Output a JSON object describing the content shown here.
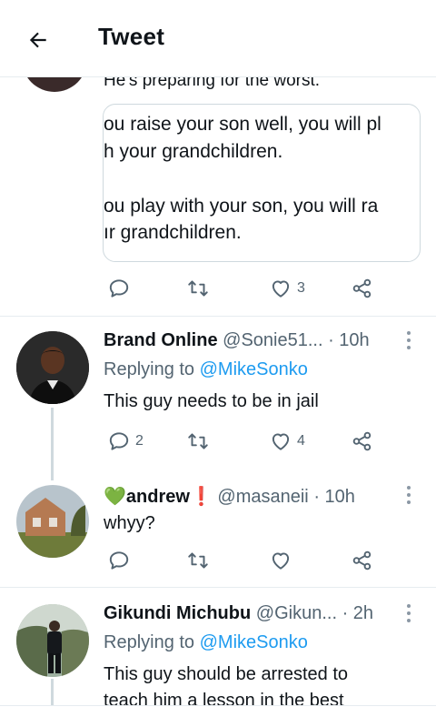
{
  "header": {
    "title": "Tweet"
  },
  "main_tweet": {
    "text_tail": "He's preparing for the worst.",
    "quote_lines": [
      "ou raise your son well, you will pl",
      "h your grandchildren.",
      "ou play with your son, you will ra",
      "ır grandchildren."
    ],
    "actions": {
      "reply": "",
      "retweet": "",
      "like": "3"
    }
  },
  "replies": [
    {
      "name": "Brand Online",
      "handle": "@Sonie51...",
      "time": "· 10h",
      "replying_prefix": "Replying to",
      "replying_to": "@MikeSonko",
      "text": "This guy needs to be in jail",
      "actions": {
        "reply": "2",
        "retweet": "",
        "like": "4"
      }
    },
    {
      "name_emoji": "💚",
      "name": "andrew",
      "name_suffix": "❗",
      "handle": "@masaneii",
      "time": "· 10h",
      "text": "whyy?",
      "actions": {
        "reply": "",
        "retweet": "",
        "like": ""
      }
    },
    {
      "name": "Gikundi Michubu",
      "handle": "@Gikun...",
      "time": "· 2h",
      "replying_prefix": "Replying to",
      "replying_to": "@MikeSonko",
      "text_lines": [
        "This guy should be arrested to",
        "teach him a lesson in the best"
      ]
    }
  ],
  "colors": {
    "accent": "#1d9bf0",
    "secondary_text": "#536471",
    "border": "#cfd9de"
  }
}
